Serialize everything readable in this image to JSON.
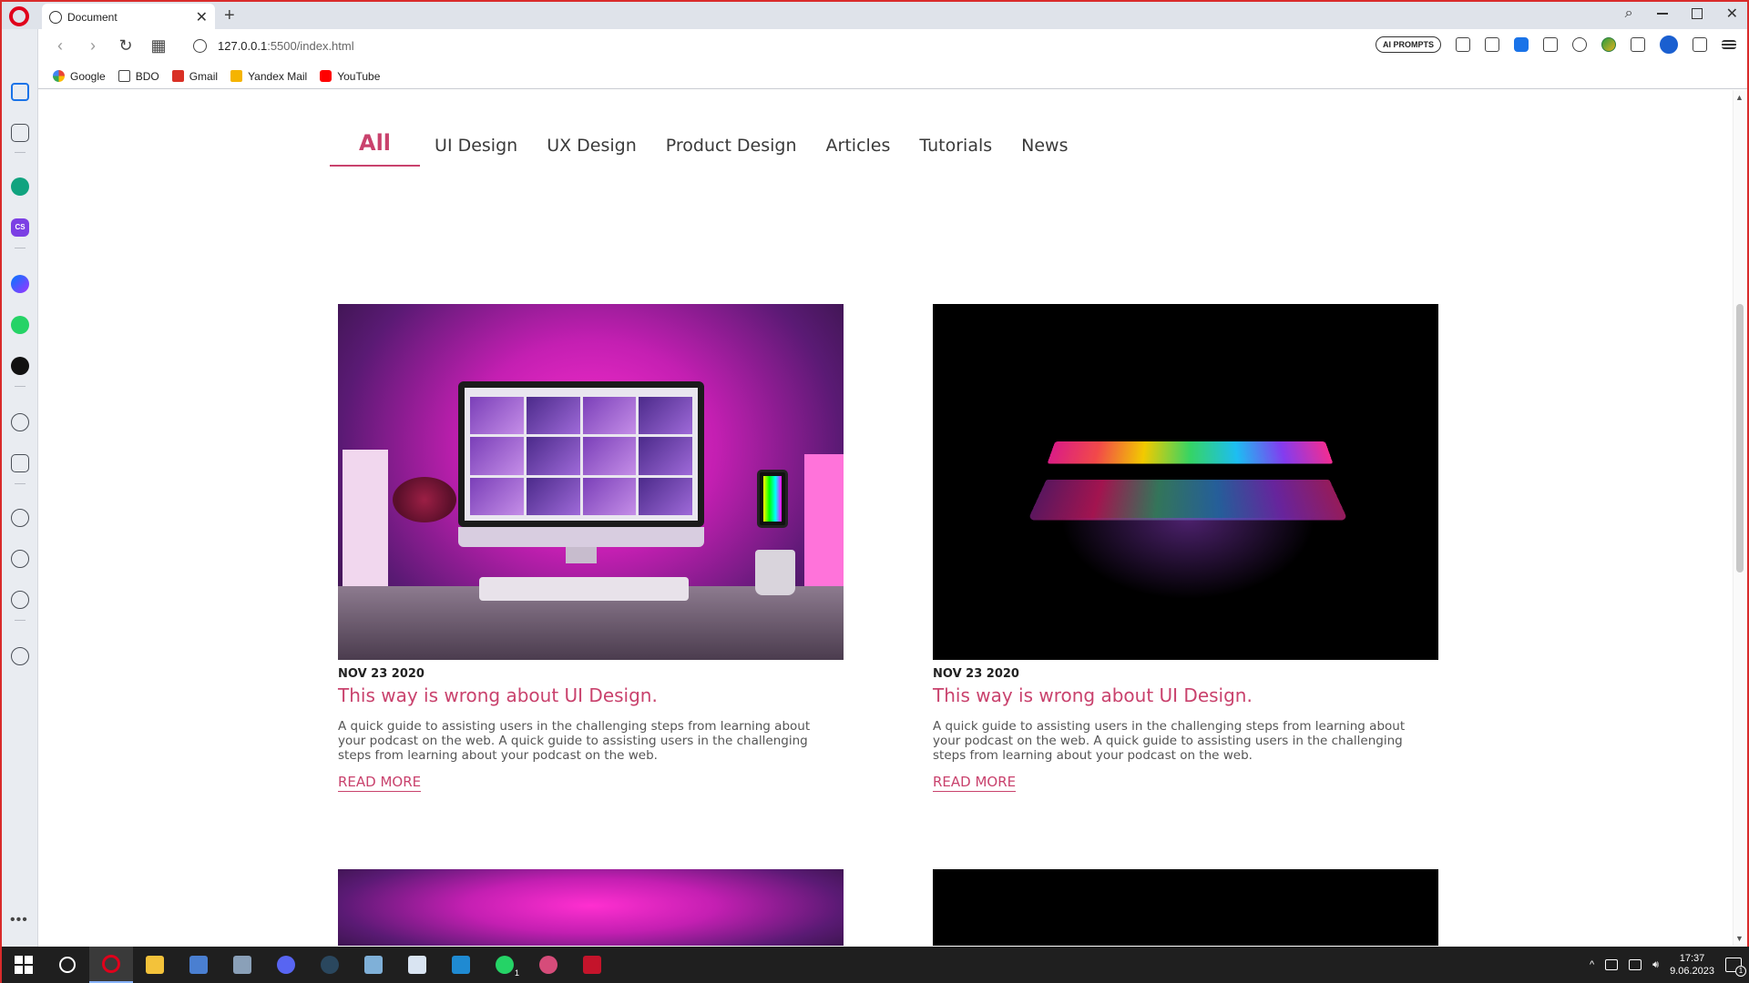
{
  "browser": {
    "tab_title": "Document",
    "url_host": "127.0.0.1",
    "url_path": ":5500/index.html",
    "ai_badge": "AI PROMPTS",
    "new_tab_glyph": "+",
    "close_glyph": "✕",
    "icons": {
      "back": "chevron-left-icon",
      "forward": "chevron-right-icon",
      "reload": "reload-icon",
      "tabs": "tab-grid-icon"
    }
  },
  "bookmarks": [
    {
      "label": "Google",
      "icon": "google-icon"
    },
    {
      "label": "BDO",
      "icon": "folder-icon"
    },
    {
      "label": "Gmail",
      "icon": "gmail-icon"
    },
    {
      "label": "Yandex Mail",
      "icon": "yandex-mail-icon"
    },
    {
      "label": "YouTube",
      "icon": "youtube-icon"
    }
  ],
  "sidebar": {
    "icons": [
      "home-icon",
      "bookmark-star-icon",
      "chatgpt-icon",
      "cs-icon",
      "messenger-icon",
      "whatsapp-icon",
      "tiktok-icon",
      "player-icon",
      "send-icon",
      "heart-icon",
      "history-icon",
      "settings-icon",
      "tips-icon"
    ],
    "more": "•••"
  },
  "page": {
    "filters": [
      "All",
      "UI Design",
      "UX Design",
      "Product Design",
      "Articles",
      "Tutorials",
      "News"
    ],
    "active_filter": "All",
    "cards": [
      {
        "date": "NOV 23 2020",
        "title": "This way is wrong about UI Design.",
        "description": "A quick guide to assisting users in the challenging steps from learning about your podcast on the web. A quick guide to assisting users in the challenging steps from learning about your podcast on the web.",
        "link": "READ MORE",
        "image": "pink-desk-setup"
      },
      {
        "date": "NOV 23 2020",
        "title": "This way is wrong about UI Design.",
        "description": "A quick guide to assisting users in the challenging steps from learning about your podcast on the web. A quick guide to assisting users in the challenging steps from learning about your podcast on the web.",
        "link": "READ MORE",
        "image": "rgb-laptop-dark"
      }
    ]
  },
  "taskbar": {
    "apps": [
      "windows-start-icon",
      "search-icon",
      "opera-icon",
      "file-explorer-icon",
      "calculator-icon",
      "photos-icon",
      "discord-icon",
      "steam-icon",
      "notepad-icon",
      "paint-icon",
      "vscode-icon",
      "whatsapp-icon",
      "paint3d-icon",
      "video-editor-icon"
    ],
    "whatsapp_badge": "1",
    "time": "17:37",
    "date": "9.06.2023",
    "notification_count": "1"
  },
  "colors": {
    "accent": "#c9426d",
    "opera_red": "#e0001b",
    "taskbar": "#1f1f1f"
  }
}
